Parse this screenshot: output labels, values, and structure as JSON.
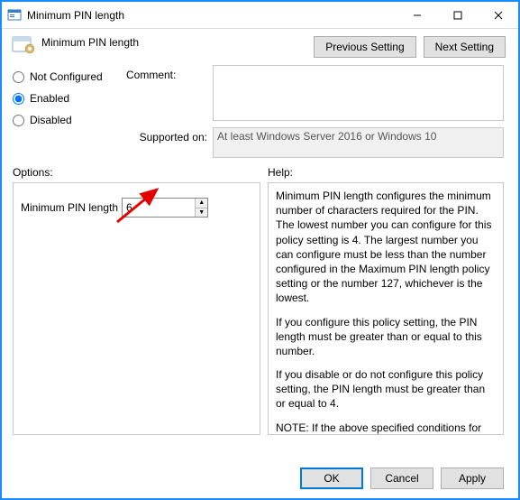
{
  "window": {
    "title": "Minimum PIN length",
    "subtitle": "Minimum PIN length"
  },
  "nav": {
    "prev": "Previous Setting",
    "next": "Next Setting"
  },
  "state": {
    "not_configured_label": "Not Configured",
    "enabled_label": "Enabled",
    "disabled_label": "Disabled",
    "selected": "enabled"
  },
  "comment": {
    "label": "Comment:",
    "value": ""
  },
  "supported": {
    "label": "Supported on:",
    "value": "At least Windows Server 2016 or Windows 10"
  },
  "options": {
    "heading": "Options:",
    "pin_label": "Minimum PIN length",
    "pin_value": "6"
  },
  "help": {
    "heading": "Help:",
    "p1": "Minimum PIN length configures the minimum number of characters required for the PIN.  The lowest number you can configure for this policy setting is 4.  The largest number you can configure must be less than the number configured in the Maximum PIN length policy setting or the number 127, whichever is the lowest.",
    "p2": "If you configure this policy setting, the PIN length must be greater than or equal to this number.",
    "p3": "If you disable or do not configure this policy setting, the PIN length must be greater than or equal to 4.",
    "p4": "NOTE: If the above specified conditions for the minimum PIN length are not met, default values will be used for both the maximum and minimum PIN lengths."
  },
  "footer": {
    "ok": "OK",
    "cancel": "Cancel",
    "apply": "Apply"
  }
}
